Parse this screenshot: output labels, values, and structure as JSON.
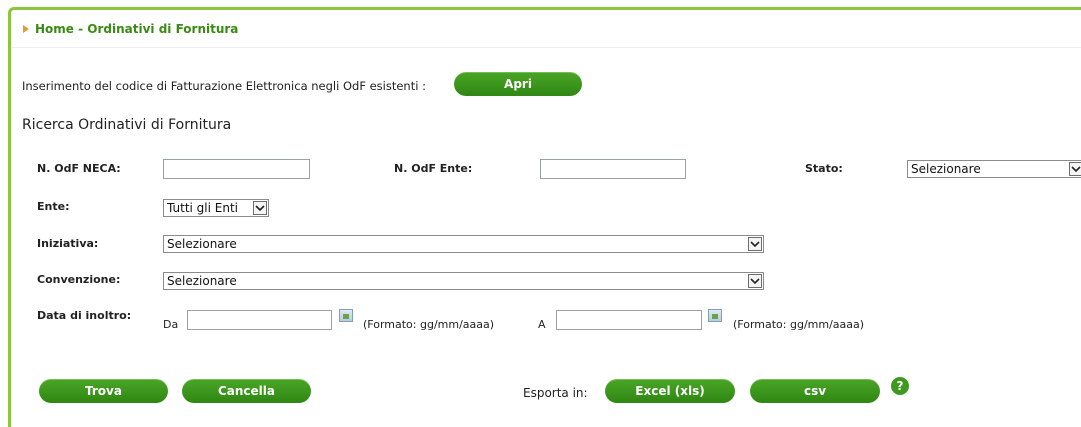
{
  "breadcrumb": {
    "text": "Home - Ordinativi di Fornitura"
  },
  "intro": {
    "text": "Inserimento del codice di Fatturazione Elettronica negli OdF esistenti :",
    "open_button": "Apri"
  },
  "search": {
    "title": "Ricerca Ordinativi di Fornitura",
    "n_odf_neca_label": "N. OdF NECA:",
    "n_odf_ente_label": "N. OdF Ente:",
    "stato_label": "Stato:",
    "stato_value": "Selezionare",
    "ente_label": "Ente:",
    "ente_value": "Tutti gli Enti",
    "iniziativa_label": "Iniziativa:",
    "iniziativa_value": "Selezionare",
    "convenzione_label": "Convenzione:",
    "convenzione_value": "Selezionare",
    "data_label": "Data di inoltro:",
    "da_label": "Da",
    "a_label": "A",
    "format_hint_1": "(Formato: gg/mm/aaaa)",
    "format_hint_2": "(Formato: gg/mm/aaaa)"
  },
  "actions": {
    "trova": "Trova",
    "cancella": "Cancella",
    "esporta_label": "Esporta in:",
    "excel": "Excel (xls)",
    "csv": "csv",
    "help": "?"
  },
  "icons": {
    "breadcrumb": "triangle-right-icon",
    "calendar": "calendar-icon",
    "dropdown": "chevron-down-icon",
    "help": "help-icon"
  },
  "colors": {
    "accent": "#3a8a14",
    "frame": "#8cc63f",
    "button": "#3e9a1f",
    "bullet": "#e49b2a"
  }
}
